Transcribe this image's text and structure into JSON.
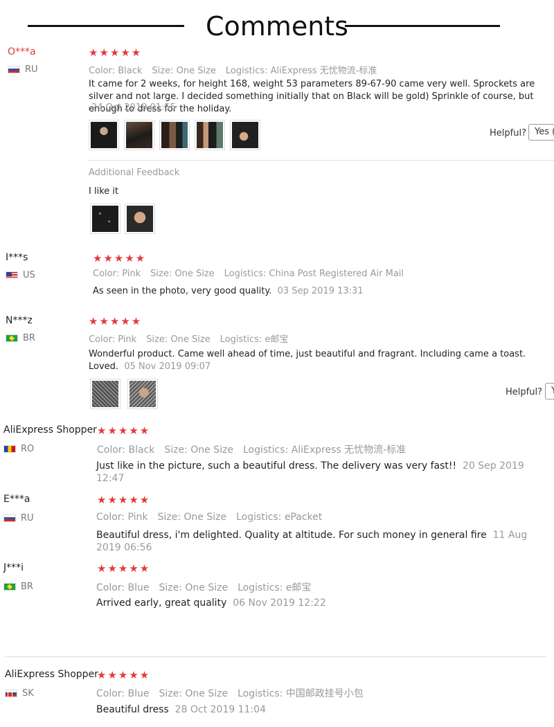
{
  "header": {
    "title": "Comments"
  },
  "reviews": [
    {
      "user": "O***a",
      "country": "RU",
      "stars": "★★★★★",
      "color": "Color: Black",
      "size": "Size: One Size",
      "logistics": "Logistics: AliExpress 无忧物流-标准",
      "text": "It came for 2 weeks, for height 168, weight 53 parameters 89-67-90 came very well. Sprockets are silver and not large. I decided something initially that on Black will be gold) Sprinkle of course, but enough to dress for the holiday.",
      "date": "24 Oct 2019 01:55",
      "helpful_label": "Helpful?",
      "yes_label": "Yes (",
      "additional_feedback_label": "Additional Feedback",
      "additional_text": "I like it"
    },
    {
      "user": "I***s",
      "country": "US",
      "stars": "★★★★★",
      "color": "Color: Pink",
      "size": "Size: One Size",
      "logistics": "Logistics: China Post Registered Air Mail",
      "text": "As seen in the photo, very good quality.",
      "date": "03 Sep 2019 13:31"
    },
    {
      "user": "N***z",
      "country": "BR",
      "stars": "★★★★★",
      "color": "Color: Pink",
      "size": "Size: One Size",
      "logistics": "Logistics: e邮宝",
      "text": "Wonderful product. Came well ahead of time, just beautiful and fragrant. Including came a toast. Loved.",
      "date": "05 Nov 2019 09:07",
      "helpful_label": "Helpful?",
      "yes_label": "Y"
    },
    {
      "user": "AliExpress Shopper",
      "country": "RO",
      "stars": "★★★★★",
      "color": "Color: Black",
      "size": "Size: One Size",
      "logistics": "Logistics: AliExpress 无忧物流-标准",
      "text": "Just like in the picture, such a beautiful dress. The delivery was very fast!!",
      "date": "20 Sep 2019 12:47"
    },
    {
      "user": "E***a",
      "country": "RU",
      "stars": "★★★★★",
      "color": "Color: Pink",
      "size": "Size: One Size",
      "logistics": "Logistics: ePacket",
      "text": "Beautiful dress, i'm delighted. Quality at altitude. For such money in general fire",
      "date": "11 Aug 2019 06:56"
    },
    {
      "user": "J***i",
      "country": "BR",
      "stars": "★★★★★",
      "color": "Color: Blue",
      "size": "Size: One Size",
      "logistics": "Logistics: e邮宝",
      "text": "Arrived early, great quality",
      "date": "06 Nov 2019 12:22"
    },
    {
      "user": "AliExpress Shopper",
      "country": "SK",
      "stars": "★★★★★",
      "color": "Color: Blue",
      "size": "Size: One Size",
      "logistics": "Logistics: 中国邮政挂号小包",
      "text": "Beautiful dress",
      "date": "28 Oct 2019 11:04"
    }
  ]
}
